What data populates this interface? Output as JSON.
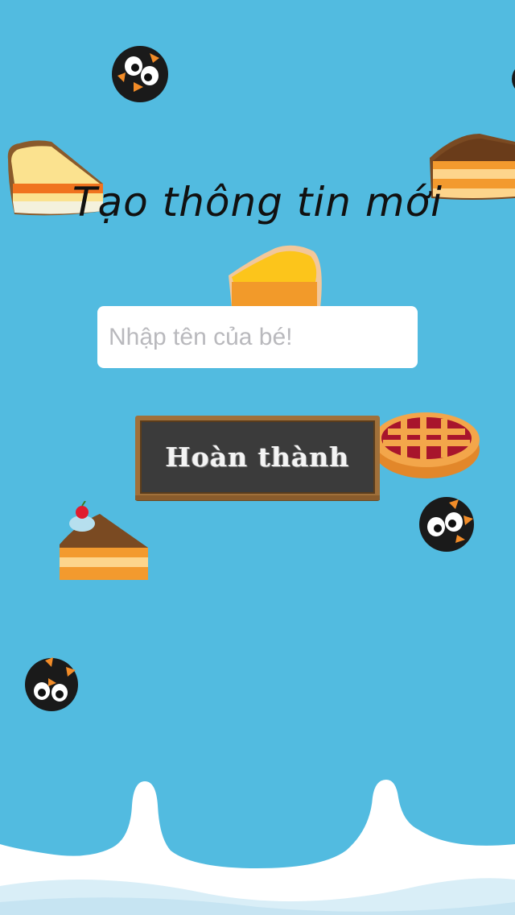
{
  "screen": {
    "title": "Tạo thông tin mới",
    "name_input": {
      "value": "",
      "placeholder": "Nhập tên của bé!"
    },
    "done_button_label": "Hoàn thành"
  },
  "colors": {
    "sky": "#52bbe0",
    "input_background": "#ffffff",
    "chalkboard": "#3b3b3b",
    "chalkboard_frame": "#a0703a",
    "snow": "#ffffff"
  },
  "decorations": [
    "penguin-icon",
    "cake-slice-icon",
    "cheese-cake-icon",
    "lemon-pie-icon",
    "cherry-pie-icon",
    "cherry-cake-icon",
    "snow-ground"
  ]
}
